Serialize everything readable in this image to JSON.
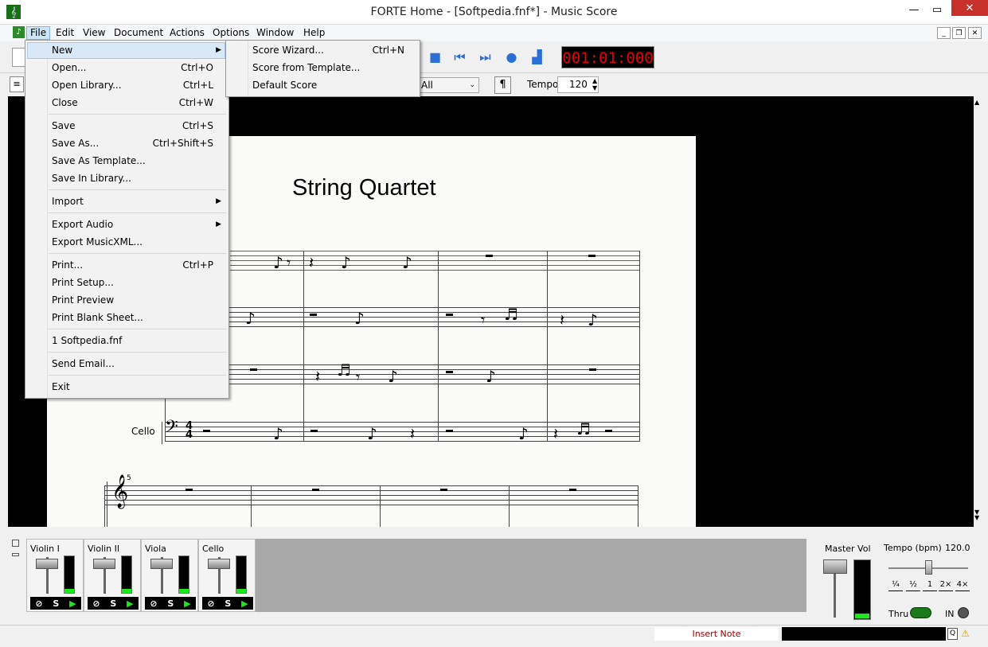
{
  "window": {
    "title": "FORTE Home - [Softpedia.fnf*] - Music Score"
  },
  "menubar": [
    "File",
    "Edit",
    "View",
    "Document",
    "Actions",
    "Options",
    "Window",
    "Help"
  ],
  "toolbar": {
    "time": "001:01:000",
    "track_filter": "All",
    "pilcrow": "¶",
    "tempo_label": "Tempo",
    "tempo_value": "120"
  },
  "score": {
    "title": "String Quartet",
    "cello_label": "Cello",
    "measure_number": "5",
    "time_sig_top": "4",
    "time_sig_bottom": "4"
  },
  "file_menu": {
    "items": [
      {
        "label": "New",
        "shortcut": ""
      },
      {
        "label": "Open...",
        "shortcut": "Ctrl+O"
      },
      {
        "label": "Open Library...",
        "shortcut": "Ctrl+L"
      },
      {
        "label": "Close",
        "shortcut": "Ctrl+W"
      },
      {
        "label": "Save",
        "shortcut": "Ctrl+S"
      },
      {
        "label": "Save As...",
        "shortcut": "Ctrl+Shift+S"
      },
      {
        "label": "Save As Template...",
        "shortcut": ""
      },
      {
        "label": "Save In Library...",
        "shortcut": ""
      },
      {
        "label": "Import",
        "shortcut": ""
      },
      {
        "label": "Export Audio",
        "shortcut": ""
      },
      {
        "label": "Export MusicXML...",
        "shortcut": ""
      },
      {
        "label": "Print...",
        "shortcut": "Ctrl+P"
      },
      {
        "label": "Print Setup...",
        "shortcut": ""
      },
      {
        "label": "Print Preview",
        "shortcut": ""
      },
      {
        "label": "Print Blank Sheet...",
        "shortcut": ""
      },
      {
        "label": "1 Softpedia.fnf",
        "shortcut": ""
      },
      {
        "label": "Send Email...",
        "shortcut": ""
      },
      {
        "label": "Exit",
        "shortcut": ""
      }
    ]
  },
  "new_submenu": {
    "items": [
      {
        "label": "Score Wizard...",
        "shortcut": "Ctrl+N"
      },
      {
        "label": "Score from Template...",
        "shortcut": ""
      },
      {
        "label": "Default Score",
        "shortcut": ""
      }
    ]
  },
  "mixer": {
    "channels": [
      "Violin I",
      "Violin II",
      "Viola",
      "Cello"
    ],
    "channel_buttons": {
      "mute": "⊘",
      "solo": "S",
      "play": "▶"
    },
    "master_label": "Master Vol",
    "tempo_label": "Tempo (bpm)",
    "tempo_value": "120.0",
    "speed_options": [
      "¼",
      "½",
      "1",
      "2×",
      "4×"
    ],
    "thru_label": "Thru",
    "in_label": "IN"
  },
  "status": {
    "mode": "Insert Note"
  }
}
